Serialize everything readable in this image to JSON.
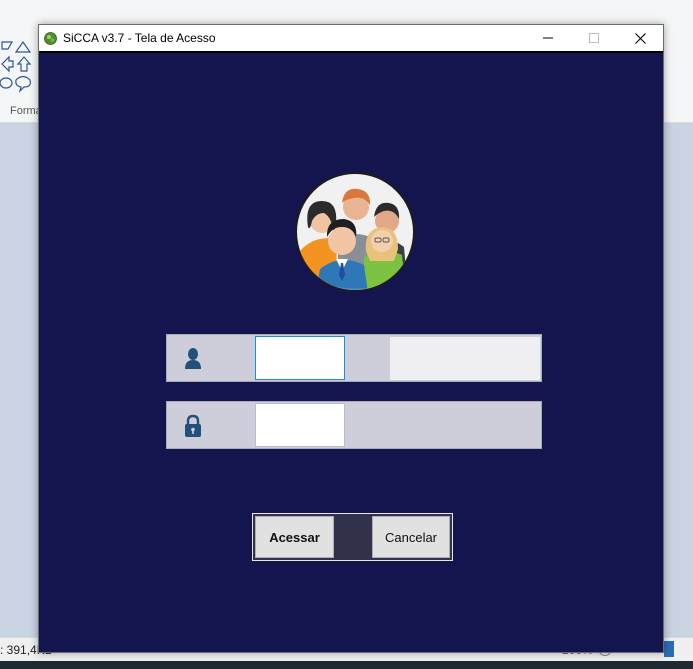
{
  "window": {
    "title": "SiCCA v3.7 - Tela de Acesso"
  },
  "background_app": {
    "format_label": "Forma",
    "file_size": ": 391,4KB",
    "zoom": "200%"
  },
  "login": {
    "username_value": "",
    "password_value": "",
    "submit_label": "Acessar",
    "cancel_label": "Cancelar"
  },
  "icons": {
    "app": "app-logo-icon",
    "avatar": "users-group-icon",
    "user": "user-icon",
    "lock": "lock-icon"
  },
  "colors": {
    "window_background": "#14154f",
    "field_background": "#cdced9",
    "icon_color": "#21507a"
  }
}
